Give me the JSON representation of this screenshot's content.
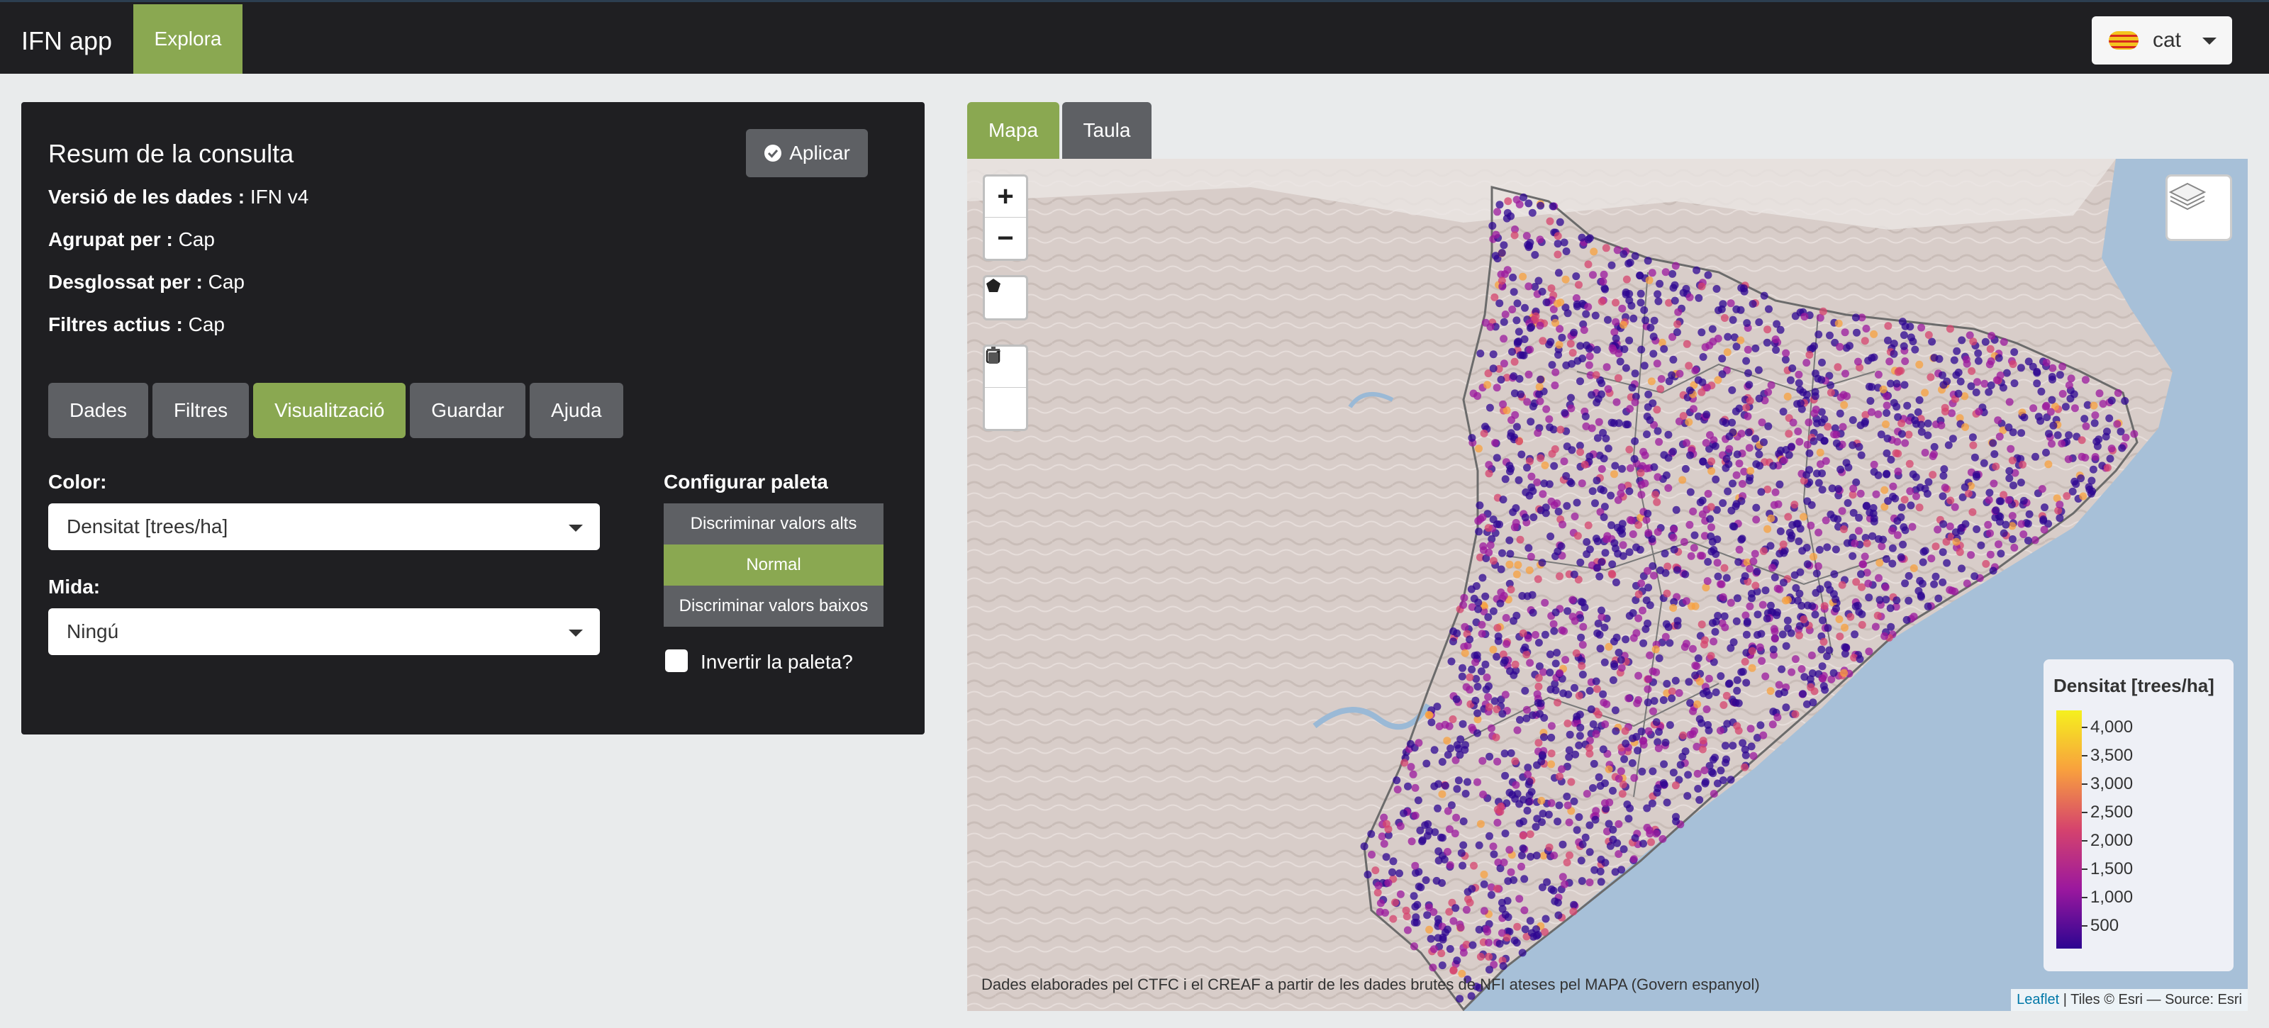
{
  "navbar": {
    "brand": "IFN app",
    "tab": "Explora",
    "language": "cat"
  },
  "summary": {
    "title": "Resum de la consulta",
    "apply_label": "Aplicar",
    "rows": [
      {
        "key": "Versió de les dades :",
        "value": "IFN v4"
      },
      {
        "key": "Agrupat per :",
        "value": "Cap"
      },
      {
        "key": "Desglossat per :",
        "value": "Cap"
      },
      {
        "key": "Filtres actius :",
        "value": "Cap"
      }
    ]
  },
  "panel_tabs": [
    "Dades",
    "Filtres",
    "Visualització",
    "Guardar",
    "Ajuda"
  ],
  "active_panel_tab": "Visualització",
  "viz": {
    "color_label": "Color:",
    "color_value": "Densitat [trees/ha]",
    "size_label": "Mida:",
    "size_value": "Ningú",
    "palette_label": "Configurar paleta",
    "palette_options": [
      "Discriminar valors alts",
      "Normal",
      "Discriminar valors baixos"
    ],
    "palette_selected": "Normal",
    "invert_label": "Invertir la paleta?",
    "invert_checked": false
  },
  "map_tabs": [
    "Mapa",
    "Taula"
  ],
  "active_map_tab": "Mapa",
  "map": {
    "controls": {
      "zoom_in": "+",
      "zoom_out": "−"
    },
    "legend": {
      "title": "Densitat [trees/ha]",
      "ticks": [
        "4,000",
        "3,500",
        "3,000",
        "2,500",
        "2,000",
        "1,500",
        "1,000",
        "500"
      ],
      "colors": [
        "#f5f01e",
        "#f8a03e",
        "#d5436d",
        "#9b189e",
        "#2d0591"
      ]
    },
    "source_note": "Dades elaborades pel CTFC i el CREAF a partir de les dades brutes de NFI ateses pel MAPA (Govern espanyol)",
    "attribution_link": "Leaflet",
    "attribution_text": " | Tiles © Esri — Source: Esri"
  },
  "colors": {
    "accent": "#8aa851",
    "navbar": "#1f1f22",
    "button_grey": "#5e6064",
    "sea": "#a7c0d8",
    "land": "#d9cfcb"
  }
}
